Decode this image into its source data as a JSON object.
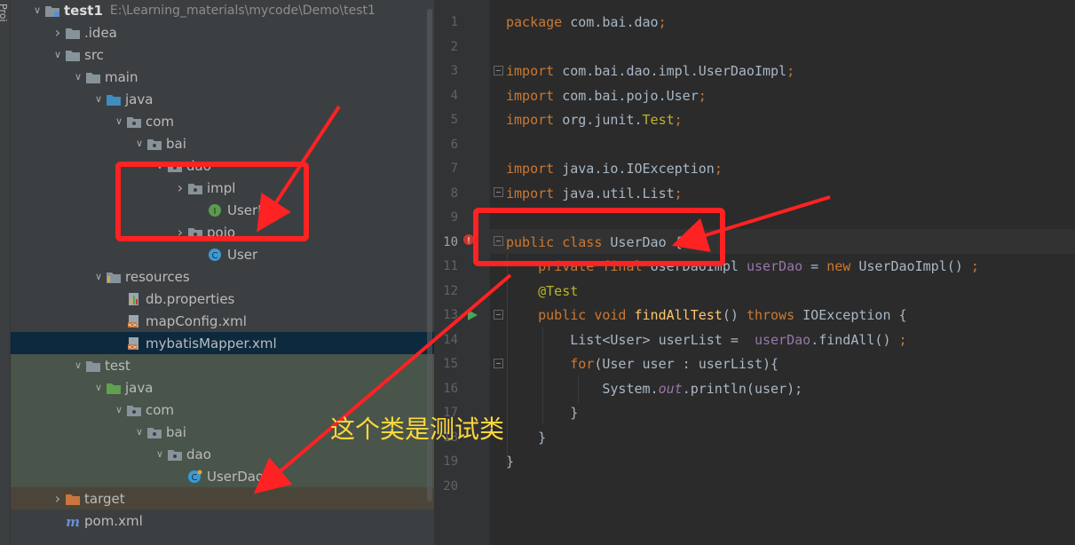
{
  "tool_window": {
    "label": "Proj"
  },
  "tree": [
    {
      "label": "test1",
      "path": "E:\\Learning_materials\\mycode\\Demo\\test1",
      "expanded": true,
      "icon": "module-folder-icon"
    },
    {
      "label": ".idea",
      "expanded": false,
      "icon": "folder-icon"
    },
    {
      "label": "src",
      "expanded": true,
      "icon": "folder-icon"
    },
    {
      "label": "main",
      "expanded": true,
      "icon": "folder-icon"
    },
    {
      "label": "java",
      "expanded": true,
      "icon": "source-root-icon"
    },
    {
      "label": "com",
      "expanded": true,
      "icon": "package-icon"
    },
    {
      "label": "bai",
      "expanded": true,
      "icon": "package-icon"
    },
    {
      "label": "dao",
      "expanded": true,
      "icon": "package-icon"
    },
    {
      "label": "impl",
      "expanded": false,
      "icon": "package-icon"
    },
    {
      "label": "UserDao",
      "icon": "interface-icon"
    },
    {
      "label": "pojo",
      "expanded": false,
      "icon": "package-icon"
    },
    {
      "label": "User",
      "icon": "class-icon"
    },
    {
      "label": "resources",
      "expanded": true,
      "icon": "resources-root-icon"
    },
    {
      "label": "db.properties",
      "icon": "properties-file-icon"
    },
    {
      "label": "mapConfig.xml",
      "icon": "xml-file-icon"
    },
    {
      "label": "mybatisMapper.xml",
      "icon": "xml-file-icon",
      "selected": true
    },
    {
      "label": "test",
      "expanded": true,
      "icon": "folder-icon"
    },
    {
      "label": "java",
      "expanded": true,
      "icon": "test-root-icon"
    },
    {
      "label": "com",
      "expanded": true,
      "icon": "package-icon"
    },
    {
      "label": "bai",
      "expanded": true,
      "icon": "package-icon"
    },
    {
      "label": "dao",
      "expanded": true,
      "icon": "package-icon"
    },
    {
      "label": "UserDao",
      "icon": "test-class-icon"
    },
    {
      "label": "target",
      "expanded": false,
      "icon": "excluded-folder-icon"
    },
    {
      "label": "pom.xml",
      "icon": "maven-icon"
    }
  ],
  "editor": {
    "line_numbers": [
      "1",
      "2",
      "3",
      "4",
      "5",
      "6",
      "7",
      "8",
      "9",
      "10",
      "11",
      "12",
      "13",
      "14",
      "15",
      "16",
      "17",
      "18",
      "19",
      "20"
    ],
    "lines": [
      [
        [
          "kw",
          "package "
        ],
        [
          "pl",
          "com.bai.dao"
        ],
        [
          "kw",
          ";"
        ]
      ],
      [],
      [
        [
          "kw",
          "import "
        ],
        [
          "pl",
          "com.bai.dao.impl.UserDaoImpl"
        ],
        [
          "kw",
          ";"
        ]
      ],
      [
        [
          "kw",
          "import "
        ],
        [
          "pl",
          "com.bai.pojo.User"
        ],
        [
          "kw",
          ";"
        ]
      ],
      [
        [
          "kw",
          "import "
        ],
        [
          "pl",
          "org.junit."
        ],
        [
          "ann",
          "Test"
        ],
        [
          "kw",
          ";"
        ]
      ],
      [],
      [
        [
          "kw",
          "import "
        ],
        [
          "pl",
          "java.io.IOException"
        ],
        [
          "kw",
          ";"
        ]
      ],
      [
        [
          "kw",
          "import "
        ],
        [
          "pl",
          "java.util.List"
        ],
        [
          "kw",
          ";"
        ]
      ],
      [],
      [
        [
          "kw",
          "public class "
        ],
        [
          "pl",
          "UserDao "
        ],
        [
          "pl",
          "{"
        ]
      ],
      [
        [
          "pl",
          "    "
        ],
        [
          "kw",
          "private final "
        ],
        [
          "pl",
          "UserDaoImpl "
        ],
        [
          "fld",
          "userDao"
        ],
        [
          "pl",
          " = "
        ],
        [
          "kw",
          "new "
        ],
        [
          "pl",
          "UserDaoImpl() "
        ],
        [
          "kw",
          ";"
        ]
      ],
      [
        [
          "pl",
          "    "
        ],
        [
          "ann",
          "@Test"
        ]
      ],
      [
        [
          "pl",
          "    "
        ],
        [
          "kw",
          "public void "
        ],
        [
          "fn",
          "findAllTest"
        ],
        [
          "pl",
          "() "
        ],
        [
          "kw",
          "throws "
        ],
        [
          "pl",
          "IOException {"
        ]
      ],
      [
        [
          "pl",
          "        List<User> userList =  "
        ],
        [
          "fld",
          "userDao"
        ],
        [
          "pl",
          ".findAll() "
        ],
        [
          "kw",
          ";"
        ]
      ],
      [
        [
          "pl",
          "        "
        ],
        [
          "kw",
          "for"
        ],
        [
          "pl",
          "(User user : userList){"
        ]
      ],
      [
        [
          "pl",
          "            System."
        ],
        [
          "it",
          "out"
        ],
        [
          "pl",
          ".println(user);"
        ]
      ],
      [
        [
          "pl",
          "        }"
        ]
      ],
      [
        [
          "pl",
          "    }"
        ]
      ],
      [
        [
          "pl",
          "}"
        ]
      ],
      []
    ]
  },
  "annotation": {
    "text": "这个类是测试类"
  },
  "colors": {
    "highlight_box": "#ff2222",
    "arrow": "#ff2222",
    "annotation_text": "#ffd83b"
  }
}
